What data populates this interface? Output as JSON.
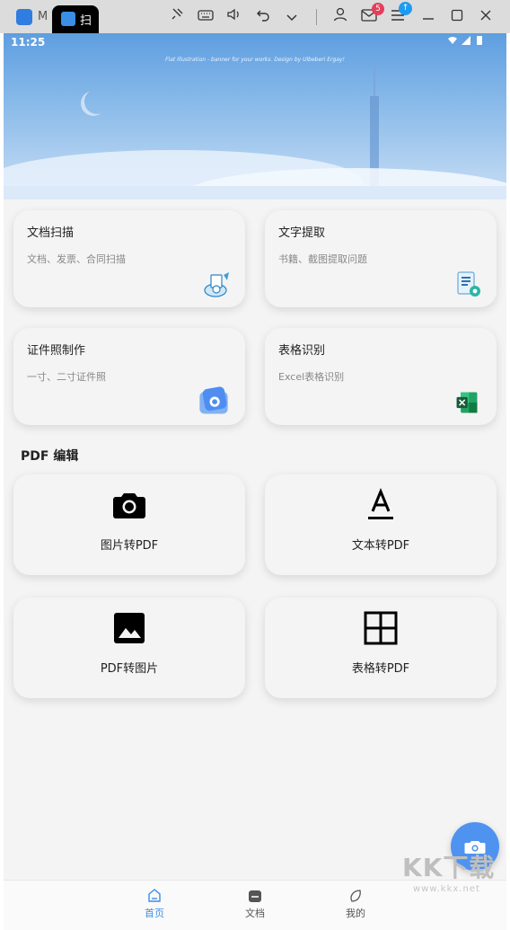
{
  "window": {
    "app_title": "M",
    "tab_title": "扫"
  },
  "toolbar": {
    "mail_badge": "5",
    "upload_badge": "↑"
  },
  "status_bar": {
    "time": "11:25"
  },
  "banner": {
    "credit": "Flat illustration - banner for your works. Design by Ulbeberi Ergay!"
  },
  "features": [
    {
      "title": "文档扫描",
      "subtitle": "文档、发票、合同扫描",
      "icon": "scanner-icon"
    },
    {
      "title": "文字提取",
      "subtitle": "书籍、截图提取问题",
      "icon": "text-extract-icon"
    },
    {
      "title": "证件照制作",
      "subtitle": "一寸、二寸证件照",
      "icon": "camera-card-icon"
    },
    {
      "title": "表格识别",
      "subtitle": "Excel表格识别",
      "icon": "excel-icon"
    }
  ],
  "pdf_section": {
    "title": "PDF 编辑",
    "tools": [
      {
        "label": "图片转PDF",
        "icon": "camera-icon"
      },
      {
        "label": "文本转PDF",
        "icon": "text-format-icon"
      },
      {
        "label": "PDF转图片",
        "icon": "image-icon"
      },
      {
        "label": "表格转PDF",
        "icon": "grid-icon"
      }
    ]
  },
  "bottom_nav": {
    "items": [
      {
        "label": "首页",
        "icon": "home-icon",
        "active": true
      },
      {
        "label": "文档",
        "icon": "document-icon",
        "active": false
      },
      {
        "label": "我的",
        "icon": "profile-icon",
        "active": false
      }
    ]
  },
  "watermark": {
    "text": "KK下载",
    "url": "www.kkx.net"
  },
  "colors": {
    "accent": "#4f93f0",
    "active_tab": "#3a8ee6",
    "banner": "#6ea6e4"
  }
}
